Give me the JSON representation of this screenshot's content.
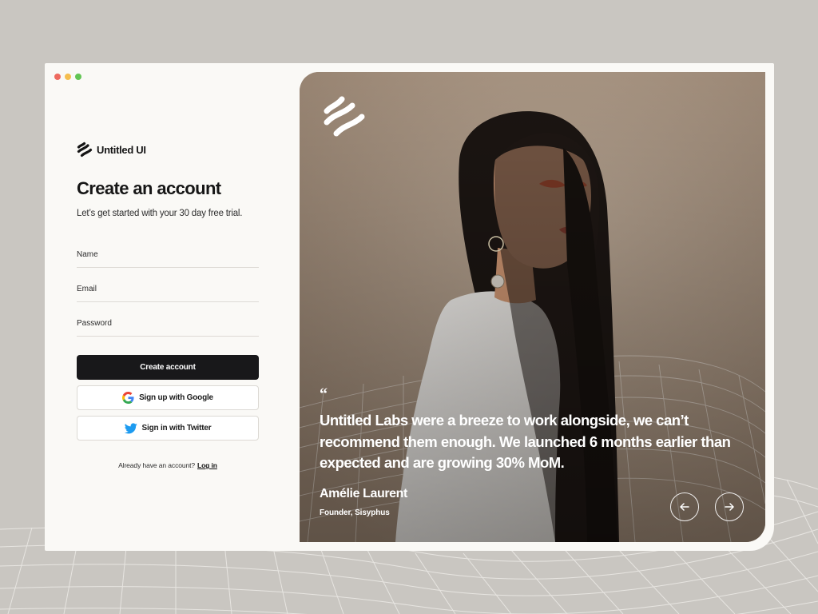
{
  "window": {
    "controls": [
      "close",
      "minimize",
      "maximize"
    ],
    "control_colors": [
      "#ee6a5f",
      "#f5be4f",
      "#62c554"
    ]
  },
  "brand": {
    "name": "Untitled UI",
    "icon": "untitled-ui-logo-icon"
  },
  "signup": {
    "heading": "Create an account",
    "subheading": "Let’s get started with your 30 day free trial.",
    "fields": {
      "name_placeholder": "Name",
      "email_placeholder": "Email",
      "password_placeholder": "Password"
    },
    "create_button": "Create account",
    "google_button": "Sign up with Google",
    "twitter_button": "Sign in with Twitter",
    "login_prompt": "Already have an account?",
    "login_link": "Log in"
  },
  "testimonial": {
    "quote_mark": "“",
    "quote": "Untitled Labs were a breeze to work alongside, we can’t recommend them enough. We launched 6 months earlier than expected and are growing 30% MoM.",
    "author": "Amélie Laurent",
    "role": "Founder, Sisyphus",
    "prev_icon": "arrow-left-icon",
    "next_icon": "arrow-right-icon"
  },
  "colors": {
    "background": "#c9c6c1",
    "panel": "#faf9f6",
    "primary_button": "#18181a",
    "photo_backdrop": "#a89584",
    "twitter_blue": "#1d9bf0"
  }
}
